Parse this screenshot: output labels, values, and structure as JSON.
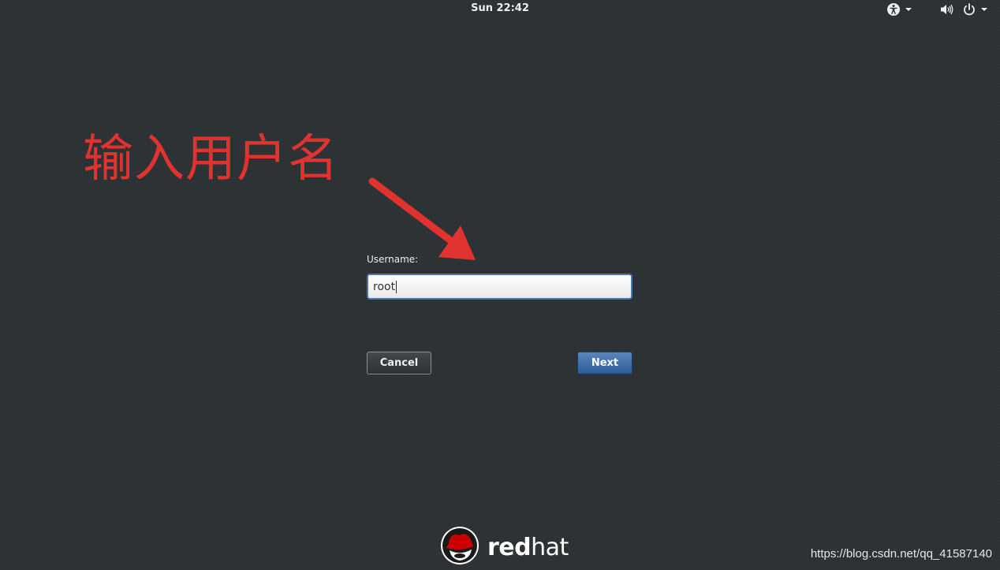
{
  "topbar": {
    "clock": "Sun 22:42",
    "icons": [
      "accessibility-icon",
      "volume-icon",
      "power-icon"
    ]
  },
  "annotation": {
    "text": "输入用户名",
    "color": "#e0332f"
  },
  "login": {
    "username_label": "Username:",
    "username_value": "root",
    "cancel_label": "Cancel",
    "next_label": "Next"
  },
  "branding": {
    "logo_text_bold": "red",
    "logo_text_light": "hat"
  },
  "watermark": "https://blog.csdn.net/qq_41587140",
  "colors": {
    "background": "#2d3235",
    "accent": "#4a78b5",
    "annotation": "#e0332f",
    "redhat": "#cc0000"
  }
}
